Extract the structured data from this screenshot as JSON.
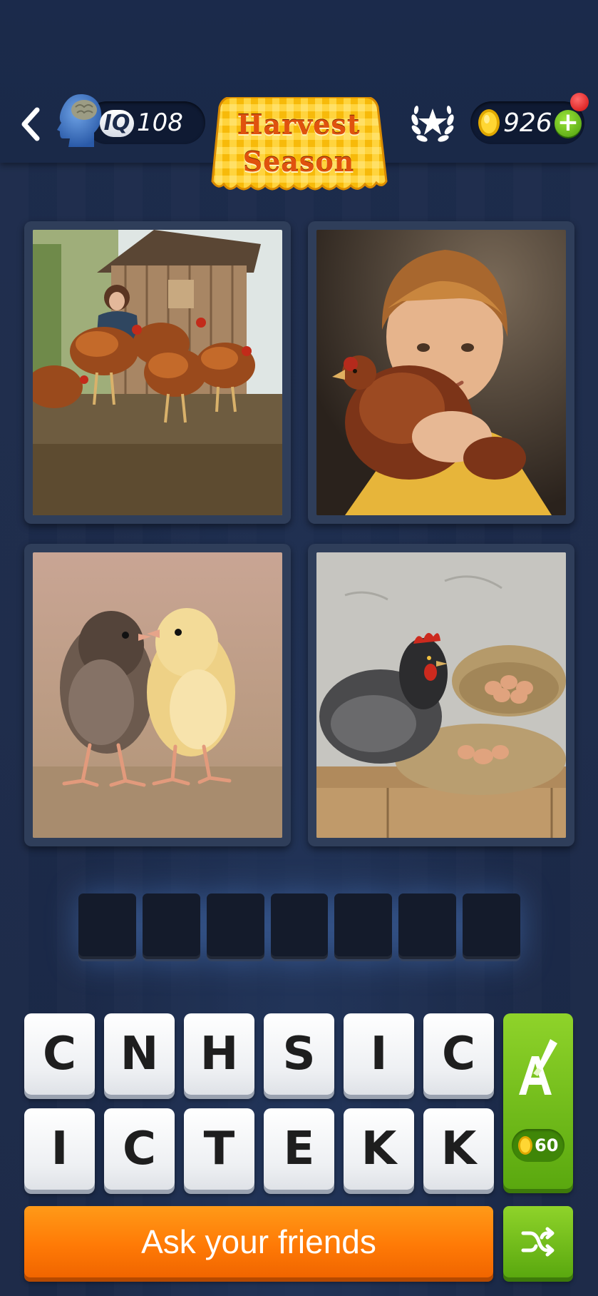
{
  "header": {
    "back_icon": "chevron-left-icon",
    "iq_label": "IQ",
    "iq_value": "108",
    "level_title_line1": "Harvest",
    "level_title_line2": "Season",
    "achievements_icon": "laurel-star-icon",
    "coins": "926",
    "add_coins_label": "+"
  },
  "puzzle": {
    "photos": [
      {
        "name": "photo-hens-at-coop",
        "subject": "woman with hens at wooden coop"
      },
      {
        "name": "photo-boy-holding-hen",
        "subject": "boy hugging brown hen"
      },
      {
        "name": "photo-two-chicks",
        "subject": "two fluffy chicks"
      },
      {
        "name": "photo-hen-with-eggs",
        "subject": "black hen beside nest with eggs"
      }
    ],
    "answer_length": 7
  },
  "letters": {
    "row1": [
      "C",
      "N",
      "H",
      "S",
      "I",
      "C"
    ],
    "row2": [
      "I",
      "C",
      "T",
      "E",
      "K",
      "K"
    ]
  },
  "hint": {
    "icon": "letter-brush-icon",
    "cost": "60"
  },
  "actions": {
    "ask_friends_label": "Ask your friends",
    "shuffle_icon": "shuffle-icon"
  },
  "colors": {
    "background": "#1b2a4a",
    "accent_orange": "#ff7a06",
    "accent_green": "#6fbf16",
    "title_orange": "#e0520e"
  }
}
